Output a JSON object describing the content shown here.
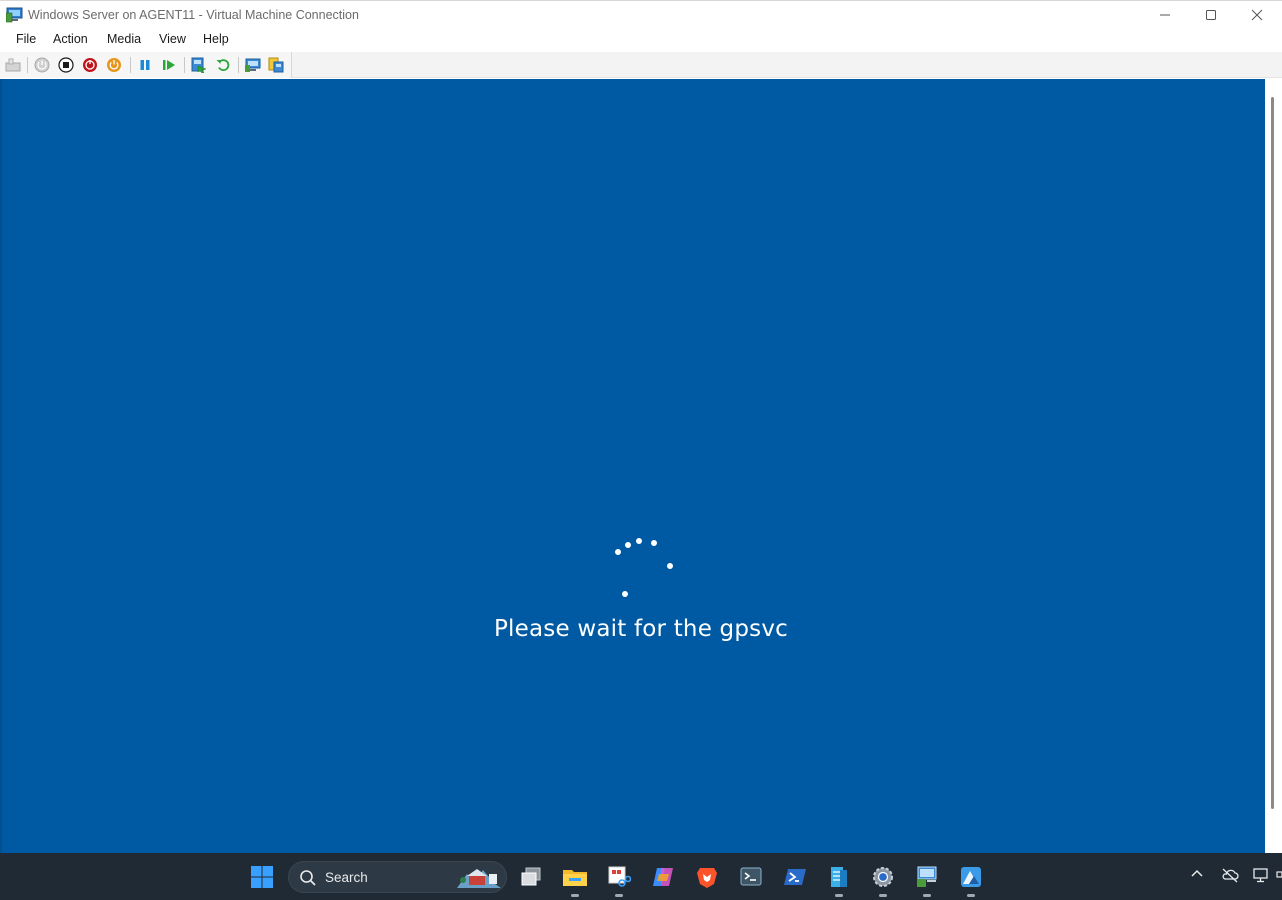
{
  "window": {
    "title": "Windows Server on AGENT11 - Virtual Machine Connection"
  },
  "menu": {
    "items": [
      "File",
      "Action",
      "Media",
      "View",
      "Help"
    ]
  },
  "toolbar": {
    "buttons": [
      {
        "name": "ctrl-alt-del-icon"
      },
      {
        "name": "start-icon"
      },
      {
        "name": "turn-off-icon"
      },
      {
        "name": "shut-down-icon"
      },
      {
        "name": "save-icon"
      },
      {
        "name": "pause-icon"
      },
      {
        "name": "resume-icon"
      },
      {
        "name": "checkpoint-icon"
      },
      {
        "name": "revert-icon"
      },
      {
        "name": "enhanced-session-icon"
      },
      {
        "name": "share-icon"
      }
    ]
  },
  "vm": {
    "background_color": "#005aa3",
    "status_text": "Please wait for the gpsvc"
  },
  "taskbar": {
    "search_label": "Search",
    "apps": [
      {
        "name": "start-icon"
      },
      {
        "name": "task-view-icon"
      },
      {
        "name": "file-explorer-icon"
      },
      {
        "name": "snipping-tool-icon"
      },
      {
        "name": "copilot-icon"
      },
      {
        "name": "brave-browser-icon"
      },
      {
        "name": "terminal-icon"
      },
      {
        "name": "powershell-icon"
      },
      {
        "name": "server-manager-icon"
      },
      {
        "name": "settings-icon"
      },
      {
        "name": "hyperv-manager-icon"
      },
      {
        "name": "azure-icon"
      }
    ],
    "tray": [
      {
        "name": "chevron-up-icon"
      },
      {
        "name": "onedrive-off-icon"
      },
      {
        "name": "network-icon"
      }
    ]
  }
}
